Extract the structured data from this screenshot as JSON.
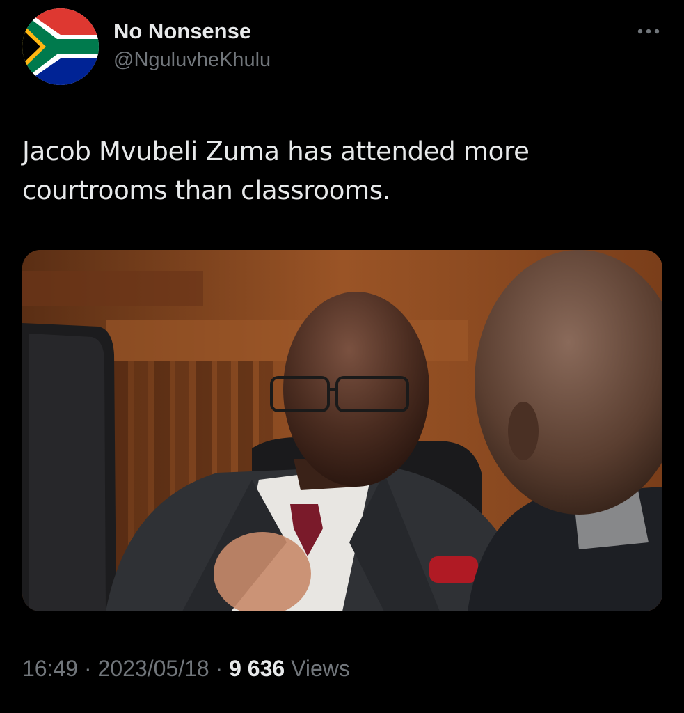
{
  "tweet": {
    "author": {
      "display_name": "No Nonsense",
      "handle": "@NguluvheKhulu",
      "avatar_icon": "south-africa-flag-icon"
    },
    "text": "Jacob Mvubeli Zuma has attended more courtrooms than classrooms.",
    "media": {
      "type": "photo",
      "alt": ""
    },
    "meta": {
      "time": "16:49",
      "separator": "·",
      "date": "2023/05/18",
      "views_count": "9 636",
      "views_label": "Views"
    },
    "more_icon": "more-options-icon"
  },
  "colors": {
    "background": "#000000",
    "primary_text": "#e7e9ea",
    "secondary_text": "#71767b",
    "divider": "#2f3336"
  }
}
